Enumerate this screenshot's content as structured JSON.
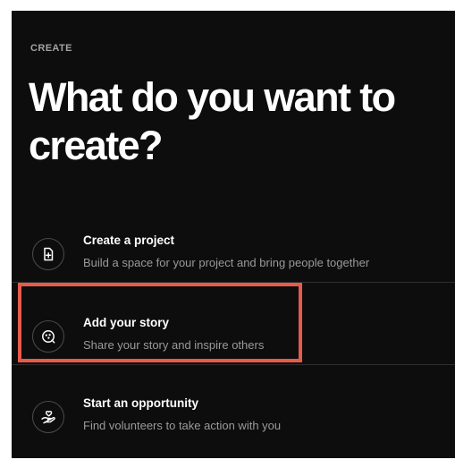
{
  "header": {
    "eyebrow": "CREATE",
    "headline": "What do you want to create?"
  },
  "options": [
    {
      "title": "Create a project",
      "description": "Build a space for your project and bring people together",
      "icon": "document-plus-icon"
    },
    {
      "title": "Add your story",
      "description": "Share your story and inspire others",
      "icon": "story-bubble-icon"
    },
    {
      "title": "Start an opportunity",
      "description": "Find volunteers to take action with you",
      "icon": "hand-heart-icon"
    }
  ],
  "colors": {
    "panel_background": "#0d0d0d",
    "highlight": "#e85a4a",
    "text_primary": "#ffffff",
    "text_secondary": "#9a9a9a"
  }
}
